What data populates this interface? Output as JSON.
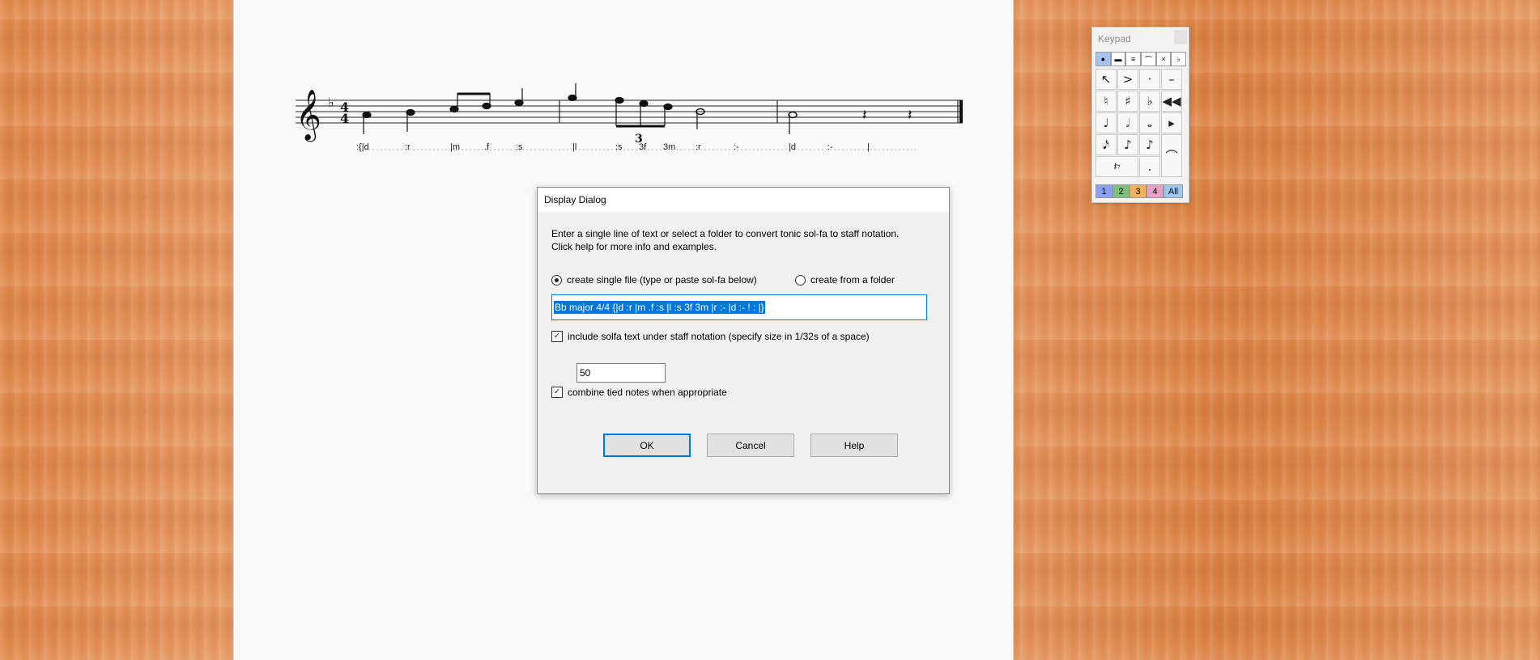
{
  "score": {
    "time_signature_top": "4",
    "time_signature_bottom": "4",
    "tuplet_number": "3",
    "solfa": [
      ":{|d",
      ":r",
      "|m",
      ".f",
      ":s",
      "|l",
      ":s",
      "3f",
      "3m",
      ":r",
      ":-",
      "|d",
      ":-",
      "|"
    ]
  },
  "dialog": {
    "title": "Display Dialog",
    "description_line1": "Enter a single line of text or select a folder to convert tonic sol-fa to staff notation.",
    "description_line2": "Click help for more info and examples.",
    "radio_single_label": "create single file (type or paste sol-fa below)",
    "radio_folder_label": "create from a folder",
    "solfa_input_value": "Bb major 4/4 {|d :r |m .f :s |l :s 3f 3m |r :- |d :- ! : |}",
    "include_solfa_label": "include solfa text under staff notation (specify size in 1/32s of a space)",
    "size_value": "50",
    "combine_tied_label": "combine tied notes when appropriate",
    "ok_label": "OK",
    "cancel_label": "Cancel",
    "help_label": "Help"
  },
  "keypad": {
    "title": "Keypad",
    "voices": [
      "1",
      "2",
      "3",
      "4",
      "All"
    ],
    "voice_colors": [
      "#8aa0f0",
      "#7cc07a",
      "#f2b15c",
      "#e8a0c8",
      "#9cc8f0"
    ]
  }
}
